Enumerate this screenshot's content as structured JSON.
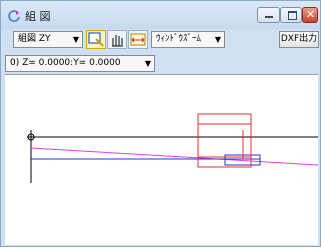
{
  "window": {
    "title": "組 図"
  },
  "titlebar": {
    "minimize_label": "",
    "maximize_label": "",
    "close_label": "✕"
  },
  "toolbar": {
    "view_select": {
      "value": "組図 ZY",
      "arrow": "▼"
    },
    "window_zoom_select": {
      "value": "ｳｨﾝﾄﾞｳｽﾞｰﾑ",
      "arrow": "▼"
    },
    "dxf_button_label": "DXF出力"
  },
  "coord_select": {
    "value": "0) Z=  0.0000:Y=  0.0000",
    "arrow": "▼"
  },
  "icons": [
    "app-refresh-icon",
    "zoom-select-icon",
    "pan-hand-icon",
    "measure-icon"
  ],
  "colors": {
    "axis": "#000000",
    "line_magenta": "#e040e0",
    "line_blue": "#3030c0",
    "outline_red": "#e03030"
  }
}
